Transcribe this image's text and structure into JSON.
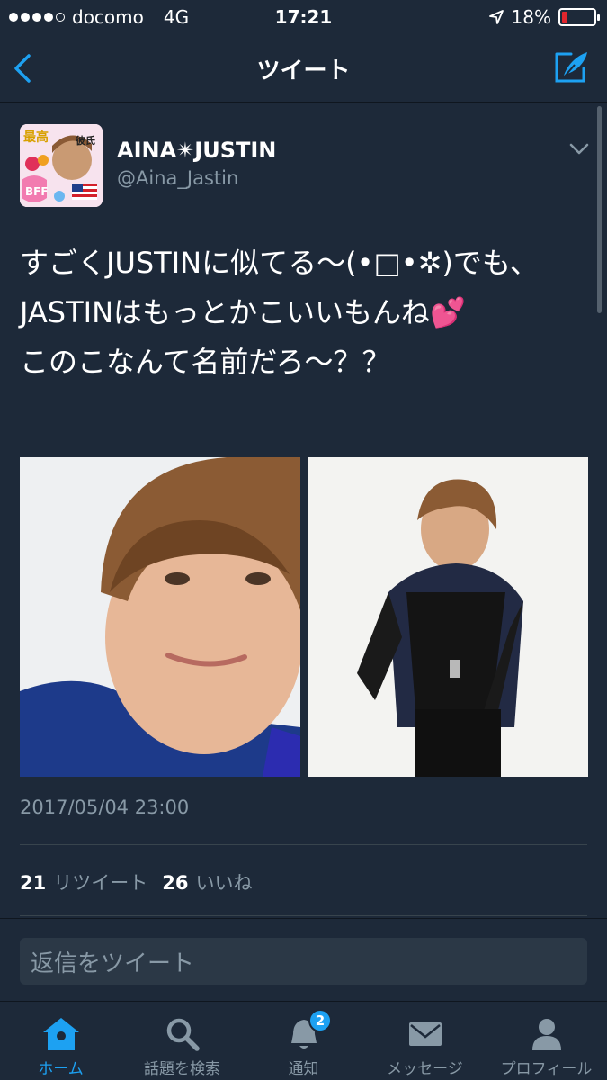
{
  "status_bar": {
    "carrier": "docomo",
    "network": "4G",
    "time": "17:21",
    "battery_percent_text": "18%",
    "battery_level": 0.18,
    "signal_bars_filled": 4,
    "signal_bars_total": 5
  },
  "nav": {
    "title": "ツイート",
    "back_icon": "chevron-left-icon",
    "compose_icon": "compose-tweet-icon"
  },
  "tweet": {
    "display_name": "AINA✴︎JUSTIN",
    "handle": "@Aina_Jastin",
    "avatar_texts": [
      "最高",
      "彼氏",
      "BFF"
    ],
    "text": "すごくJUSTINに似てる〜(•□•✲)でも、JASTINはもっとかこいいもんね💕\nこのこなんて名前だろ〜？？",
    "timestamp": "2017/05/04 23:00",
    "retweets_count": "21",
    "retweets_label": "リツイート",
    "likes_count": "26",
    "likes_label": "いいね"
  },
  "reply": {
    "placeholder": "返信をツイート"
  },
  "tab_bar": {
    "tabs": [
      {
        "label": "ホーム",
        "icon": "home-icon",
        "active": true
      },
      {
        "label": "話題を検索",
        "icon": "search-icon",
        "active": false
      },
      {
        "label": "通知",
        "icon": "bell-icon",
        "active": false,
        "badge": "2"
      },
      {
        "label": "メッセージ",
        "icon": "envelope-icon",
        "active": false
      },
      {
        "label": "プロフィール",
        "icon": "person-icon",
        "active": false
      }
    ]
  },
  "colors": {
    "background": "#1d2939",
    "accent": "#1da1f2",
    "secondary_text": "#8899a6",
    "battery_low": "#e0262d"
  }
}
